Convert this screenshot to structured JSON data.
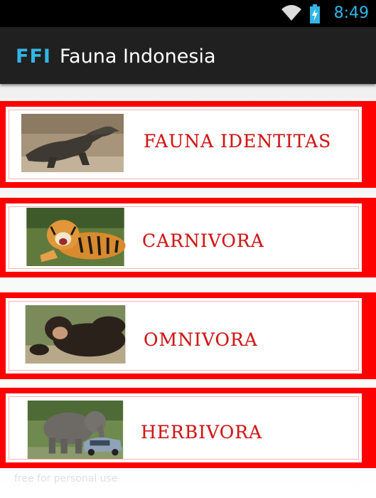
{
  "status": {
    "time": "8:49"
  },
  "appbar": {
    "logo": "FFI",
    "title": "Fauna Indonesia"
  },
  "menu": [
    {
      "label": "FAUNA IDENTITAS",
      "image": "komodo-dragon"
    },
    {
      "label": "CARNIVORA",
      "image": "tiger"
    },
    {
      "label": "OMNIVORA",
      "image": "chimpanzee"
    },
    {
      "label": "HERBIVORA",
      "image": "elephant"
    }
  ],
  "watermark": "free for personal use",
  "colors": {
    "accent": "#33b5e5",
    "frame": "#ff0000",
    "label": "#d01818",
    "actionbar": "#202020"
  }
}
